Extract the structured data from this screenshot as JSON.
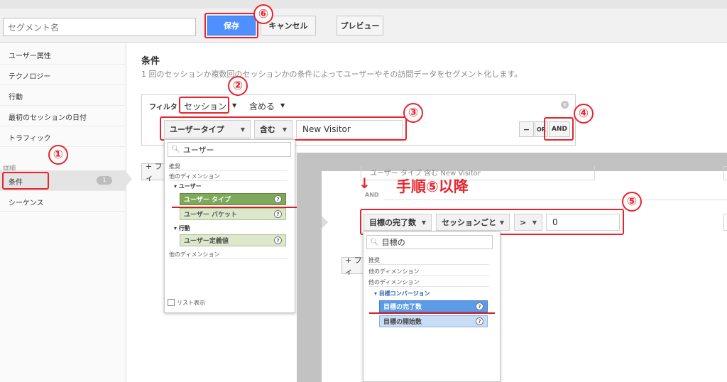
{
  "top": {
    "segment_placeholder": "セグメント名",
    "save_label": "保存",
    "cancel_label": "キャンセル",
    "preview_label": "プレビュー"
  },
  "sidebar": {
    "items": [
      "ユーザー属性",
      "テクノロジー",
      "行動",
      "最初のセッションの日付",
      "トラフィック"
    ],
    "section_label": "詳細",
    "conditions_label": "条件",
    "conditions_badge": "1",
    "sequences_label": "シーケンス"
  },
  "main": {
    "title": "条件",
    "description": "1 回のセッションか複数回のセッションかの条件によってユーザーやその訪問データをセグメント化します。",
    "filter_label": "フィルタ",
    "scope": "セッション",
    "include": "含める",
    "dimension": "ユーザータイプ",
    "operator": "含む",
    "value": "New   Visitor",
    "minus_label": "−",
    "or_label": "OR",
    "and_label": "AND",
    "add_filter": "+ フィ"
  },
  "popup1": {
    "search_value": "ユーザー",
    "recommended": "推奨",
    "other_dims": "他のディメンション",
    "cat_user": "▾ ユーザー",
    "item_user_type": "ユーザー タイプ",
    "item_user_bucket": "ユーザー バケット",
    "cat_behavior": "▾ 行動",
    "item_user_defined": "ユーザー定義値",
    "other_dims2": "他のディメンション",
    "list_view": "リスト表示"
  },
  "overlay": {
    "faded_row": "ユーザー タイプ  含む  New Visitor",
    "arrow": "↓",
    "and_label": "AND",
    "step_text": "手順⑤以降",
    "metric": "目標の完了数",
    "per": "セッションごと",
    "comparator": ">",
    "value": "0",
    "add_filter": "+ フィ"
  },
  "popup2": {
    "search_value": "目標の",
    "recommended": "推奨",
    "other_dims": "他のディメンション",
    "other_dims2": "他のディメンション",
    "cat_goal": "▾ 目標コンバージョン",
    "item_goal_completions": "目標の完了数",
    "item_goal_starts": "目標の開始数"
  },
  "markers": [
    "①",
    "②",
    "③",
    "④",
    "⑤",
    "⑥"
  ],
  "colors": {
    "annotation_red": "#e8242c",
    "save_blue": "#4d90fe",
    "chip_green": "#7ea85a",
    "chip_blue": "#5c9be8"
  }
}
